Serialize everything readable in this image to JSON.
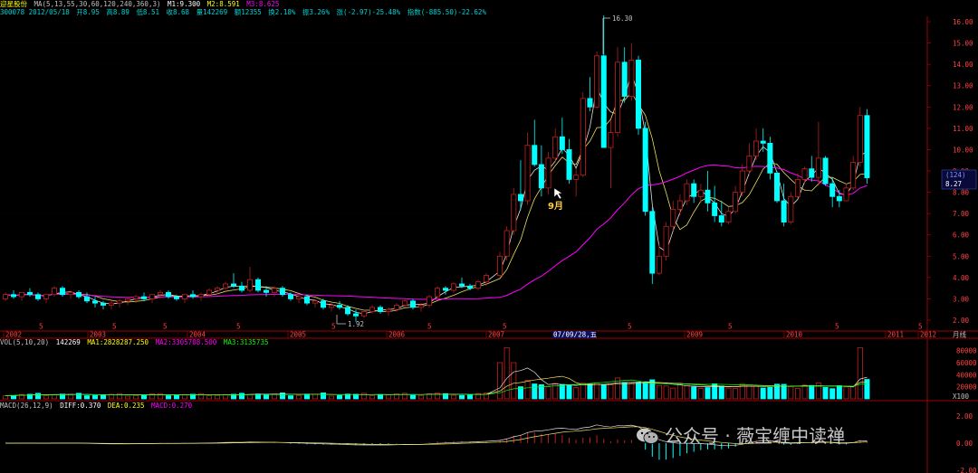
{
  "header": {
    "line1": {
      "stock_name": "迎星股份",
      "ma_params": "MA(5,13,55,30,60,120,240,360,3)",
      "m1": "M1:9.300",
      "m2": "M2:8.591",
      "m3": "M3:8.625"
    },
    "line2": {
      "code_date": "300078 2012/05/18",
      "open": "开8.95",
      "high": "高8.89",
      "low": "低8.51",
      "close": "收8.68",
      "volume": "量142269",
      "amount": "额12355",
      "turnover": "换2.18%",
      "amplitude": "振3.26%",
      "change": "涨(-2.97)-25.48%",
      "index": "指数(-885.50)-22.62%"
    }
  },
  "price_axis": {
    "ticks": [
      "2.00",
      "3.00",
      "4.00",
      "5.00",
      "6.00",
      "7.00",
      "8.00",
      "9.00",
      "10.00",
      "11.00",
      "12.00",
      "13.00",
      "14.00",
      "15.00",
      "16.00"
    ],
    "current_label": "(124)",
    "current_price": "8.27"
  },
  "annotations": {
    "high_label": "16.30",
    "low_label": "1.92",
    "sept_label": "9月",
    "date_tag": "07/09/28,五"
  },
  "x_axis": {
    "years": [
      "2002",
      "2003",
      "2004",
      "2005",
      "2006",
      "2007",
      "2008",
      "2009",
      "2010",
      "2011",
      "2012"
    ],
    "period_label": "月线",
    "markers": [
      "5",
      "5",
      "5",
      "5",
      "5",
      "5",
      "5",
      "5",
      "5",
      "5",
      "5"
    ]
  },
  "vol_panel": {
    "header": "VOL(5,10,20)",
    "value": "142269",
    "ma1": "MA1:2828287.250",
    "ma2": "MA2:3305708.500",
    "ma3": "MA3:3135735",
    "ticks": [
      "20000",
      "40000",
      "60000",
      "80000"
    ],
    "unit": "X100"
  },
  "macd_panel": {
    "header": "MACD(26,12,9)",
    "diff": "DIFF:0.370",
    "dea": "DEA:0.235",
    "macd": "MACD:0.270",
    "ticks": [
      "2.00",
      "0.00",
      "-2.00"
    ]
  },
  "watermark": {
    "text": "公众号 · 薇宝缠中读禅"
  },
  "colors": {
    "up": "#ff3c3c",
    "down": "#00ffff",
    "ma_white": "#e0e0e0",
    "ma_yellow": "#e8e060",
    "ma_magenta": "#ff00ff",
    "axis_red": "#a00000",
    "vol_ma3": "#00ff00"
  },
  "chart_data": {
    "type": "candlestick",
    "x": "monthly",
    "ohlc": [
      [
        3.0,
        3.3,
        2.9,
        3.2
      ],
      [
        3.2,
        3.4,
        3.0,
        3.1
      ],
      [
        3.1,
        3.2,
        2.9,
        3.3
      ],
      [
        3.3,
        3.5,
        3.1,
        3.2
      ],
      [
        3.2,
        3.3,
        2.9,
        3.0
      ],
      [
        3.0,
        3.2,
        2.8,
        3.2
      ],
      [
        3.2,
        3.6,
        3.1,
        3.5
      ],
      [
        3.5,
        3.6,
        3.1,
        3.2
      ],
      [
        3.2,
        3.4,
        3.0,
        3.3
      ],
      [
        3.3,
        3.4,
        3.0,
        3.1
      ],
      [
        3.1,
        3.3,
        2.8,
        2.9
      ],
      [
        2.9,
        3.1,
        2.6,
        2.8
      ],
      [
        2.8,
        2.9,
        2.5,
        2.7
      ],
      [
        2.7,
        2.9,
        2.5,
        2.8
      ],
      [
        2.8,
        3.0,
        2.6,
        2.9
      ],
      [
        2.9,
        3.1,
        2.7,
        3.0
      ],
      [
        3.0,
        3.2,
        2.8,
        3.1
      ],
      [
        3.1,
        3.3,
        2.9,
        3.0
      ],
      [
        3.0,
        3.2,
        2.8,
        3.2
      ],
      [
        3.2,
        3.4,
        3.0,
        3.3
      ],
      [
        3.3,
        3.4,
        3.0,
        3.1
      ],
      [
        3.1,
        3.2,
        2.9,
        3.0
      ],
      [
        3.0,
        3.2,
        2.8,
        3.2
      ],
      [
        3.2,
        3.4,
        3.0,
        3.1
      ],
      [
        3.1,
        3.3,
        2.9,
        3.2
      ],
      [
        3.2,
        3.5,
        3.1,
        3.4
      ],
      [
        3.4,
        3.6,
        3.2,
        3.5
      ],
      [
        3.5,
        3.8,
        3.3,
        3.7
      ],
      [
        3.7,
        4.2,
        3.5,
        3.6
      ],
      [
        3.6,
        3.8,
        3.3,
        3.4
      ],
      [
        3.4,
        4.5,
        3.3,
        3.9
      ],
      [
        3.9,
        4.0,
        3.3,
        3.4
      ],
      [
        3.4,
        3.6,
        3.1,
        3.3
      ],
      [
        3.3,
        3.6,
        3.1,
        3.5
      ],
      [
        3.5,
        3.6,
        3.1,
        3.2
      ],
      [
        3.2,
        3.3,
        2.9,
        3.0
      ],
      [
        3.0,
        3.2,
        2.8,
        3.1
      ],
      [
        3.1,
        3.2,
        2.7,
        2.8
      ],
      [
        2.8,
        3.0,
        2.6,
        2.9
      ],
      [
        2.9,
        3.0,
        2.5,
        2.6
      ],
      [
        2.6,
        2.8,
        2.4,
        2.7
      ],
      [
        2.7,
        2.9,
        2.5,
        2.6
      ],
      [
        2.6,
        2.7,
        2.2,
        2.3
      ],
      [
        2.3,
        2.5,
        1.92,
        2.2
      ],
      [
        2.2,
        2.5,
        2.1,
        2.4
      ],
      [
        2.4,
        2.7,
        2.3,
        2.6
      ],
      [
        2.6,
        2.7,
        2.3,
        2.4
      ],
      [
        2.4,
        2.6,
        2.2,
        2.5
      ],
      [
        2.5,
        2.8,
        2.4,
        2.7
      ],
      [
        2.7,
        3.0,
        2.6,
        2.9
      ],
      [
        2.9,
        3.0,
        2.5,
        2.6
      ],
      [
        2.6,
        2.8,
        2.4,
        2.7
      ],
      [
        2.7,
        3.2,
        2.6,
        3.1
      ],
      [
        3.1,
        3.6,
        3.0,
        3.5
      ],
      [
        3.5,
        3.6,
        3.2,
        3.4
      ],
      [
        3.4,
        3.8,
        3.3,
        3.7
      ],
      [
        3.7,
        4.0,
        3.5,
        3.6
      ],
      [
        3.6,
        3.7,
        3.4,
        3.5
      ],
      [
        3.5,
        3.9,
        3.4,
        3.8
      ],
      [
        3.8,
        4.2,
        3.6,
        4.1
      ],
      [
        4.1,
        5.2,
        4.0,
        5.0
      ],
      [
        5.0,
        6.4,
        4.8,
        6.2
      ],
      [
        6.2,
        8.2,
        6.0,
        7.9
      ],
      [
        7.9,
        9.5,
        7.2,
        7.6
      ],
      [
        7.6,
        10.8,
        7.4,
        10.2
      ],
      [
        10.2,
        11.4,
        9.2,
        9.3
      ],
      [
        9.3,
        10.2,
        7.8,
        8.2
      ],
      [
        8.2,
        9.9,
        7.9,
        9.6
      ],
      [
        9.6,
        11.0,
        9.4,
        10.6
      ],
      [
        10.6,
        11.5,
        9.8,
        10.0
      ],
      [
        10.0,
        10.5,
        8.4,
        8.6
      ],
      [
        8.6,
        9.1,
        7.8,
        8.8
      ],
      [
        8.8,
        12.7,
        8.7,
        12.4
      ],
      [
        12.4,
        13.4,
        11.8,
        12.0
      ],
      [
        12.0,
        14.6,
        11.9,
        14.4
      ],
      [
        14.4,
        16.3,
        13.8,
        10.1
      ],
      [
        10.1,
        11.4,
        8.2,
        10.8
      ],
      [
        10.8,
        14.8,
        10.6,
        14.1
      ],
      [
        14.1,
        14.8,
        12.2,
        12.5
      ],
      [
        12.5,
        15.0,
        12.3,
        14.2
      ],
      [
        14.2,
        14.4,
        10.7,
        11.0
      ],
      [
        11.0,
        11.3,
        6.9,
        7.1
      ],
      [
        7.1,
        7.3,
        3.7,
        4.2
      ],
      [
        4.2,
        5.6,
        4.1,
        5.0
      ],
      [
        5.0,
        6.6,
        4.8,
        6.4
      ]
    ]
  }
}
